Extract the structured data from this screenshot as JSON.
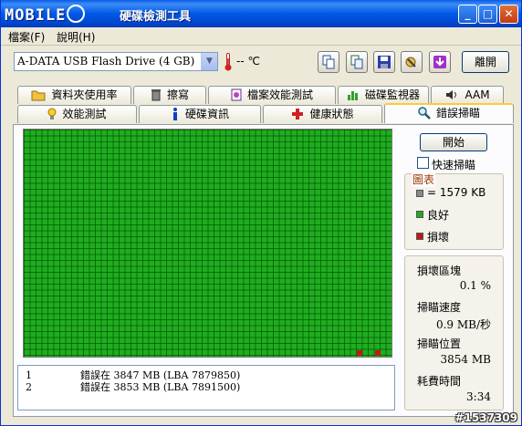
{
  "window": {
    "logo_text": "MOBILE",
    "title": "硬碟檢測工具"
  },
  "menu": {
    "items": [
      "檔案(F)",
      "說明(H)"
    ]
  },
  "toolbar": {
    "drive": "A-DATA  USB Flash Drive (4 GB)",
    "temperature": "-- ℃",
    "detach_label": "離開",
    "icon_buttons": [
      "copy-icon",
      "copy-alt-icon",
      "save-icon",
      "options-icon",
      "download-icon"
    ]
  },
  "tabs": {
    "row1": [
      "資料夾使用率",
      "擦寫",
      "檔案效能測試",
      "磁碟監視器",
      "AAM"
    ],
    "row2": [
      "效能測試",
      "硬碟資訊",
      "健康狀態",
      "錯誤掃瞄"
    ],
    "active": "錯誤掃瞄"
  },
  "scan": {
    "start_label": "開始",
    "quick_scan_label": "快速掃瞄",
    "quick_scan_checked": false,
    "colors": {
      "good": "#1fad1f",
      "bad": "#c01818",
      "block": "#888888"
    },
    "bad_blocks": [
      {
        "col": 56,
        "row": 37
      },
      {
        "col": 59,
        "row": 37
      }
    ]
  },
  "legend": {
    "title": "圖表",
    "block_size": "= 1579 KB",
    "good": "良好",
    "bad": "損壞"
  },
  "stats": {
    "damaged_label": "損壞區塊",
    "damaged_value": "0.1 %",
    "speed_label": "掃瞄速度",
    "speed_value": "0.9 MB/秒",
    "position_label": "掃瞄位置",
    "position_value": "3854 MB",
    "time_label": "耗費時間",
    "time_value": "3:34"
  },
  "log": [
    {
      "num": "1",
      "text": "錯誤在 3847 MB (LBA 7879850)"
    },
    {
      "num": "2",
      "text": "錯誤在 3853 MB (LBA 7891500)"
    }
  ],
  "watermark": "#1537309"
}
